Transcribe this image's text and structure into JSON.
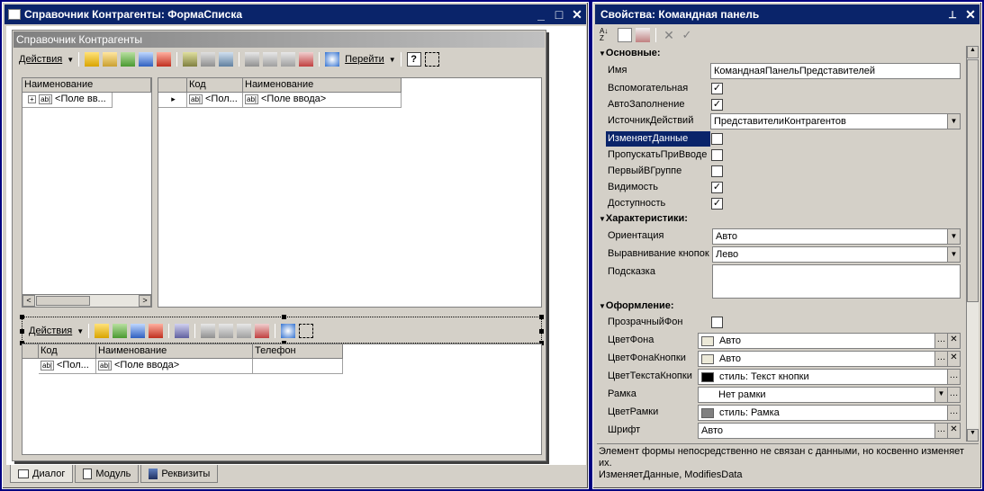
{
  "left_window": {
    "title": "Справочник Контрагенты: ФормаСписка",
    "form_header": "Справочник Контрагенты",
    "toolbar1": {
      "actions": "Действия",
      "goto": "Перейти"
    },
    "tree": {
      "header": "Наименование",
      "cell": "<Поле вв..."
    },
    "main_grid": {
      "headers": [
        "Код",
        "Наименование"
      ],
      "cells": [
        "<Пол...",
        "<Поле ввода>"
      ]
    },
    "toolbar2": {
      "actions": "Действия"
    },
    "lower_grid": {
      "headers": [
        "Код",
        "Наименование",
        "Телефон"
      ],
      "cells": [
        "<Пол...",
        "<Поле ввода>"
      ]
    },
    "tabs": [
      "Диалог",
      "Модуль",
      "Реквизиты"
    ]
  },
  "right_window": {
    "title": "Свойства: Командная панель",
    "groups": {
      "basic": "Основные:",
      "characteristics": "Характеристики:",
      "appearance": "Оформление:"
    },
    "props": {
      "name_label": "Имя",
      "name_value": "КоманднаяПанельПредставителей",
      "aux_label": "Вспомогательная",
      "autofill_label": "АвтоЗаполнение",
      "source_label": "ИсточникДействий",
      "source_value": "ПредставителиКонтрагентов",
      "changes_label": "ИзменяетДанные",
      "skip_label": "ПропускатьПриВводе",
      "first_label": "ПервыйВГруппе",
      "visible_label": "Видимость",
      "access_label": "Доступность",
      "orient_label": "Ориентация",
      "orient_value": "Авто",
      "align_label": "Выравнивание кнопок",
      "align_value": "Лево",
      "hint_label": "Подсказка",
      "transp_label": "ПрозрачныйФон",
      "bg_label": "ЦветФона",
      "bg_value": "Авто",
      "btnbg_label": "ЦветФонаКнопки",
      "btnbg_value": "Авто",
      "btntext_label": "ЦветТекстаКнопки",
      "btntext_value": "стиль: Текст кнопки",
      "frame_label": "Рамка",
      "frame_value": "Нет рамки",
      "framecolor_label": "ЦветРамки",
      "framecolor_value": "стиль: Рамка",
      "font_label": "Шрифт",
      "font_value": "Авто"
    },
    "checks": {
      "aux": true,
      "autofill": true,
      "changes": false,
      "skip": false,
      "first": false,
      "visible": true,
      "access": true,
      "transp": false
    },
    "description": "Элемент формы непосредственно не связан с данными, но косвенно изменяет их.",
    "description2": "ИзменяетДанные, ModifiesData"
  },
  "colors": {
    "title_bg": "#0a246a",
    "selected": "#0a246a",
    "window_bg": "#d4d0c8"
  }
}
